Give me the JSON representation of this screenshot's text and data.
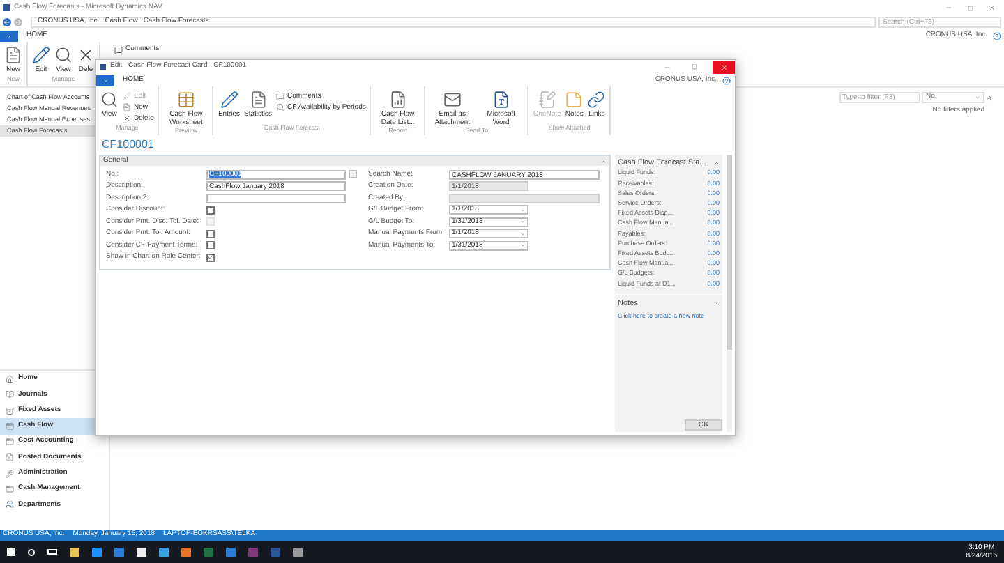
{
  "window": {
    "title": "Cash Flow Forecasts - Microsoft Dynamics NAV"
  },
  "address_bar": {
    "breadcrumbs": [
      "CRONUS USA, Inc.",
      "Cash Flow",
      "Cash Flow Forecasts"
    ],
    "search_placeholder": "Search (Ctrl+F3)"
  },
  "company": "CRONUS USA, Inc.",
  "ribbon_tab": "HOME",
  "ribbon": {
    "groups": [
      {
        "label": "New",
        "buttons": [
          {
            "label": "New",
            "kind": "large"
          }
        ]
      },
      {
        "label": "Manage",
        "buttons": [
          {
            "label": "Edit",
            "kind": "large"
          },
          {
            "label": "View",
            "kind": "large"
          },
          {
            "label": "Dele",
            "kind": "large"
          }
        ]
      }
    ],
    "small_button": "Comments"
  },
  "nav_list": [
    {
      "label": "Chart of Cash Flow Accounts",
      "selected": false
    },
    {
      "label": "Cash Flow Manual Revenues",
      "selected": false
    },
    {
      "label": "Cash Flow Manual Expenses",
      "selected": false
    },
    {
      "label": "Cash Flow Forecasts",
      "selected": true
    }
  ],
  "filter": {
    "placeholder": "Type to filter (F3)",
    "field": "No.",
    "status": "No filters applied"
  },
  "departments": [
    {
      "label": "Home",
      "selected": false
    },
    {
      "label": "Journals",
      "selected": false
    },
    {
      "label": "Fixed Assets",
      "selected": false
    },
    {
      "label": "Cash Flow",
      "selected": true
    },
    {
      "label": "Cost Accounting",
      "selected": false
    },
    {
      "label": "Posted Documents",
      "selected": false
    },
    {
      "label": "Administration",
      "selected": false
    },
    {
      "label": "Cash Management",
      "selected": false
    },
    {
      "label": "Departments",
      "selected": false
    }
  ],
  "status_bar": [
    "CRONUS USA, Inc.",
    "Monday, January 15, 2018",
    "LAPTOP-EOKRSASS\\TELKA"
  ],
  "taskbar": {
    "time": "3:10 PM",
    "date": "8/24/2016"
  },
  "dialog": {
    "title": "Edit - Cash Flow Forecast Card - CF100001",
    "tab": "HOME",
    "company": "CRONUS USA, Inc.",
    "ribbon": [
      {
        "label": "Manage",
        "buttons": [
          {
            "label": "View",
            "kind": "large",
            "disabled": false
          },
          {
            "label": "Edit",
            "kind": "small",
            "disabled": true
          },
          {
            "label": "New",
            "kind": "small",
            "disabled": false
          },
          {
            "label": "Delete",
            "kind": "small",
            "disabled": false
          }
        ]
      },
      {
        "label": "Preview",
        "buttons": [
          {
            "label": "Cash Flow Worksheet",
            "kind": "large",
            "disabled": false
          }
        ]
      },
      {
        "label": "Cash Flow Forecast",
        "buttons": [
          {
            "label": "Entries",
            "kind": "large",
            "disabled": false
          },
          {
            "label": "Statistics",
            "kind": "large",
            "disabled": false
          },
          {
            "label": "Comments",
            "kind": "small",
            "disabled": false
          },
          {
            "label": "CF Availability by Periods",
            "kind": "small",
            "disabled": false
          }
        ]
      },
      {
        "label": "Report",
        "buttons": [
          {
            "label": "Cash Flow Date List...",
            "kind": "large",
            "disabled": false
          }
        ]
      },
      {
        "label": "Send To",
        "buttons": [
          {
            "label": "Email as Attachment",
            "kind": "large",
            "disabled": false
          },
          {
            "label": "Microsoft Word",
            "kind": "large",
            "disabled": false
          }
        ]
      },
      {
        "label": "Show Attached",
        "buttons": [
          {
            "label": "OneNote",
            "kind": "large",
            "disabled": true
          },
          {
            "label": "Notes",
            "kind": "large",
            "disabled": false
          },
          {
            "label": "Links",
            "kind": "large",
            "disabled": false
          }
        ]
      }
    ],
    "record_title": "CF100001",
    "fasttab": "General",
    "left_fields": [
      {
        "label": "No.:",
        "kind": "lookup",
        "value": "CF100001",
        "selected": true
      },
      {
        "label": "Description:",
        "kind": "text",
        "value": "CashFlow January 2018"
      },
      {
        "label": "Description 2:",
        "kind": "text"
      },
      {
        "label": "Consider Discount:",
        "kind": "checkbox",
        "checked": false,
        "disabled": false
      },
      {
        "label": "Consider Pmt. Disc. Tol. Date:",
        "kind": "checkbox",
        "checked": false,
        "disabled": true
      },
      {
        "label": "Consider Pmt. Tol. Amount:",
        "kind": "checkbox",
        "checked": false,
        "disabled": false
      },
      {
        "label": "Consider CF Payment Terms:",
        "kind": "checkbox",
        "checked": false,
        "disabled": false
      },
      {
        "label": "Show in Chart on Role Center:",
        "kind": "checkbox",
        "checked": true,
        "disabled": false
      }
    ],
    "right_fields": [
      {
        "label": "Search Name:",
        "kind": "text",
        "value": "CASHFLOW JANUARY 2018"
      },
      {
        "label": "Creation Date:",
        "kind": "readonly",
        "value": "1/1/2018"
      },
      {
        "label": "Created By:",
        "kind": "readonly_wide"
      },
      {
        "label": "G/L Budget From:",
        "kind": "date",
        "value": "1/1/2018"
      },
      {
        "label": "G/L Budget To:",
        "kind": "date",
        "value": "1/31/2018"
      },
      {
        "label": "Manual Payments From:",
        "kind": "date",
        "value": "1/1/2018"
      },
      {
        "label": "Manual Payments To:",
        "kind": "date",
        "value": "1/31/2018"
      }
    ],
    "factbox": {
      "title": "Cash Flow Forecast Sta...",
      "rows": [
        {
          "label": "Liquid Funds:",
          "value": "0.00"
        },
        {
          "label": "Receivables:",
          "value": "0.00"
        },
        {
          "label": "Sales Orders:",
          "value": "0.00"
        },
        {
          "label": "Service Orders:",
          "value": "0.00"
        },
        {
          "label": "Fixed Assets Disp...",
          "value": "0.00"
        },
        {
          "label": "Cash Flow Manual...",
          "value": "0.00"
        },
        {
          "label": "Payables:",
          "value": "0.00"
        },
        {
          "label": "Purchase Orders:",
          "value": "0.00"
        },
        {
          "label": "Fixed Assets Budg...",
          "value": "0.00"
        },
        {
          "label": "Cash Flow Manual...",
          "value": "0.00"
        },
        {
          "label": "G/L Budgets:",
          "value": "0.00"
        },
        {
          "label": "Liquid Funds at D1...",
          "value": "0.00"
        }
      ]
    },
    "notes": {
      "title": "Notes",
      "link": "Click here to create a new note"
    },
    "ok_button": "OK"
  }
}
